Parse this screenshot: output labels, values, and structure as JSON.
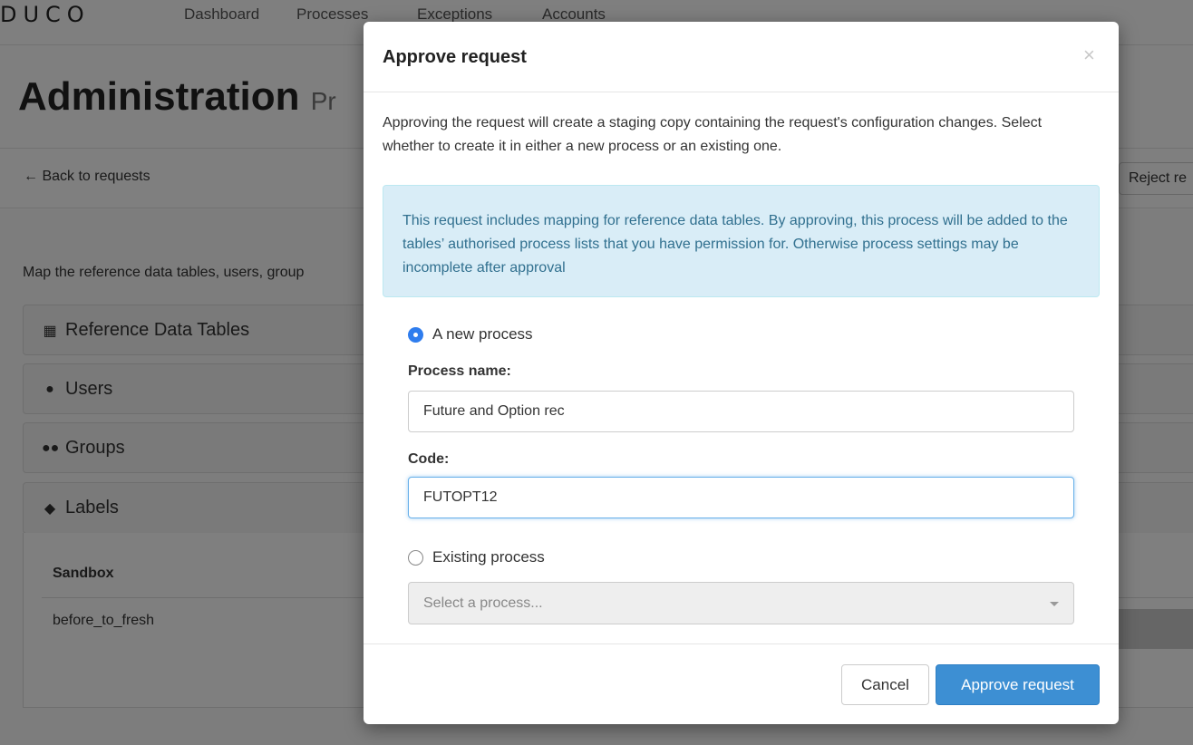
{
  "app": {
    "logo": "DUCO",
    "nav": [
      {
        "label": "Dashboard"
      },
      {
        "label": "Processes"
      },
      {
        "label": "Exceptions"
      },
      {
        "label": "Accounts"
      }
    ]
  },
  "page": {
    "title": "Administration",
    "subtitle": "Pr",
    "back_label": "Back to requests",
    "reject_label": "Reject re",
    "map_text": "Map the reference data tables, users, group",
    "panels": {
      "reference": {
        "label": "Reference Data Tables",
        "icon": "table-icon"
      },
      "users": {
        "label": "Users",
        "icon": "user-icon"
      },
      "groups": {
        "label": "Groups",
        "icon": "users-icon"
      },
      "labels": {
        "label": "Labels",
        "icon": "tag-icon"
      }
    },
    "labels_table": {
      "header": "Sandbox",
      "value": "before_to_fresh"
    }
  },
  "modal": {
    "title": "Approve request",
    "close_label": "×",
    "description": "Approving the request will create a staging copy containing the request's configuration changes. Select whether to create it in either a new process or an existing one.",
    "alert": "This request includes mapping for reference data tables. By approving, this process will be added to the tables’ authorised process lists that you have permission for. Otherwise process settings may be incomplete after approval",
    "new_process_label": "A new process",
    "process_name_label": "Process name:",
    "process_name_value": "Future and Option rec",
    "code_label": "Code:",
    "code_value": "FUTOPT12",
    "existing_process_label": "Existing process",
    "select_placeholder": "Select a process...",
    "cancel_label": "Cancel",
    "approve_label": "Approve request",
    "selected_option": "new"
  },
  "colors": {
    "primary": "#3d8fd3",
    "alert_bg": "#d9edf7",
    "alert_text": "#31708f",
    "radio_checked": "#2f7dee"
  }
}
